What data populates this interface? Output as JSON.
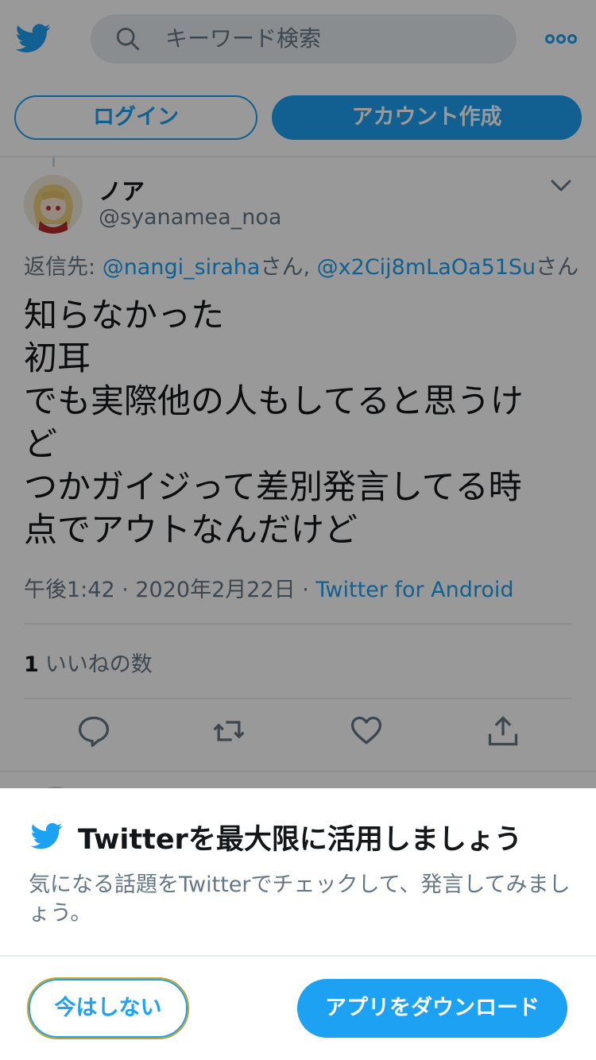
{
  "header": {
    "search_placeholder": "キーワード検索",
    "login_label": "ログイン",
    "signup_label": "アカウント作成"
  },
  "tweet": {
    "display_name": "ノア",
    "handle": "@syanamea_noa",
    "replying_prefix": "返信先: ",
    "mention1": "@nangi_siraha",
    "honorific1": "さん, ",
    "mention2": "@x2Cij8mLaOa51Su",
    "honorific2": "さん",
    "text_lines": [
      "知らなかった",
      "初耳",
      "でも実際他の人もしてると思うけ",
      "ど",
      "つかガイジって差別発言してる時",
      "点でアウトなんだけど"
    ],
    "time_date": "午後1:42 · 2020年2月22日 · ",
    "source": "Twitter for Android",
    "like_count": "1",
    "like_label": "いいねの数"
  },
  "sheet": {
    "title": "Twitterを最大限に活用しましょう",
    "description": "気になる話題をTwitterでチェックして、発言してみましょう。",
    "not_now_label": "今はしない",
    "download_label": "アプリをダウンロード"
  },
  "colors": {
    "accent": "#1da1f2",
    "secondary_text": "#657786",
    "divider": "#e6ecf0",
    "overlay": "rgba(0,0,0,0.40)"
  }
}
